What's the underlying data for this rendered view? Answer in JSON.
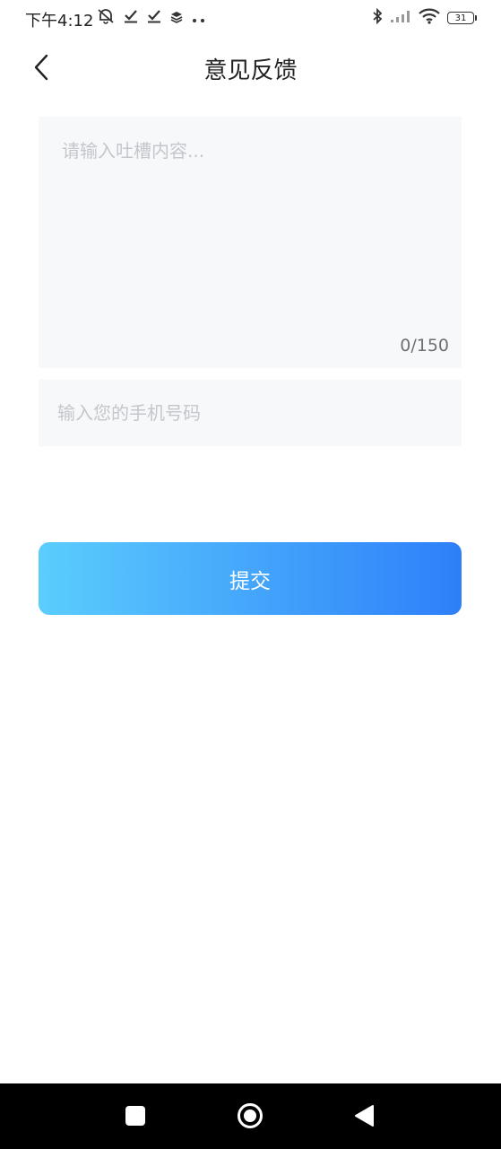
{
  "status_bar": {
    "time": "下午4:12",
    "battery": "31",
    "left_icons": [
      "mute-bell-icon",
      "check-icon",
      "check-icon",
      "layers-icon",
      "more-dots-icon"
    ],
    "right_icons": [
      "bluetooth-icon",
      "signal-icon",
      "wifi-icon",
      "battery-icon"
    ]
  },
  "header": {
    "title": "意见反馈",
    "back_icon": "chevron-left-icon"
  },
  "form": {
    "feedback_value": "",
    "feedback_placeholder": "请输入吐槽内容...",
    "char_counter": "0/150",
    "phone_value": "",
    "phone_placeholder": "输入您的手机号码",
    "submit_label": "提交"
  },
  "colors": {
    "accent_start": "#5bcdfd",
    "accent_end": "#2e7ff9",
    "field_bg": "#f7f8fa",
    "placeholder": "#c4c6cc"
  },
  "system_nav": {
    "icons": [
      "recents-square-icon",
      "home-circle-icon",
      "back-triangle-icon"
    ]
  }
}
